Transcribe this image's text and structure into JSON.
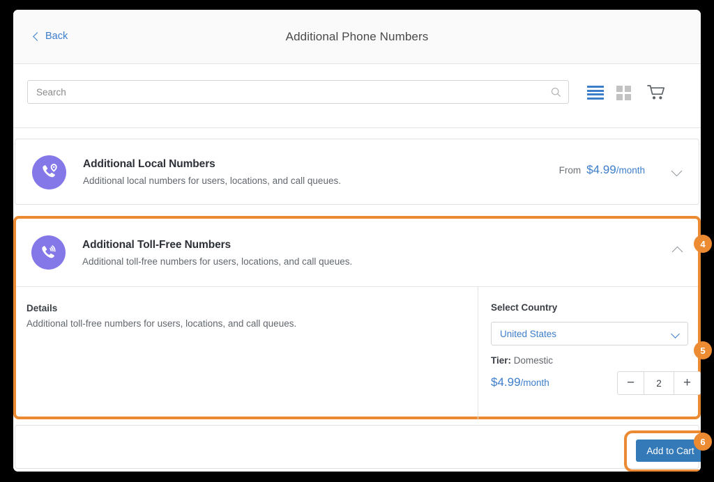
{
  "header": {
    "back_label": "Back",
    "title": "Additional Phone Numbers"
  },
  "toolbar": {
    "search_placeholder": "Search",
    "search_value": "",
    "icons": {
      "search": "search-icon",
      "list_view": "list-view-icon",
      "grid_view": "grid-view-icon",
      "cart": "cart-icon"
    }
  },
  "products": [
    {
      "id": "additional-local-numbers",
      "title": "Additional Local Numbers",
      "subtitle": "Additional local numbers for users, locations, and call queues.",
      "price_prefix": "From",
      "price": "$4.99",
      "price_period": "/month",
      "expanded": false,
      "chevron": "chevron-down-icon"
    },
    {
      "id": "additional-toll-free-numbers",
      "title": "Additional Toll-Free Numbers",
      "subtitle": "Additional toll-free numbers for users, locations, and call queues.",
      "expanded": true,
      "chevron": "chevron-up-icon",
      "details_label": "Details",
      "details_text": "Additional toll-free numbers for users, locations, and call queues.",
      "country_label": "Select Country",
      "country_value": "United States",
      "tier_label": "Tier:",
      "tier_value": "Domestic",
      "price": "$4.99",
      "price_period": "/month",
      "quantity": "2",
      "decrement_label": "−",
      "increment_label": "+"
    }
  ],
  "footer": {
    "add_to_cart_label": "Add to Cart"
  },
  "annotations": {
    "badges": [
      "4",
      "5",
      "6"
    ]
  },
  "colors": {
    "accent_blue": "#3d7ecb",
    "button_blue": "#357ab8",
    "highlight_orange": "#ec8a33",
    "icon_purple": "#8478e8"
  }
}
